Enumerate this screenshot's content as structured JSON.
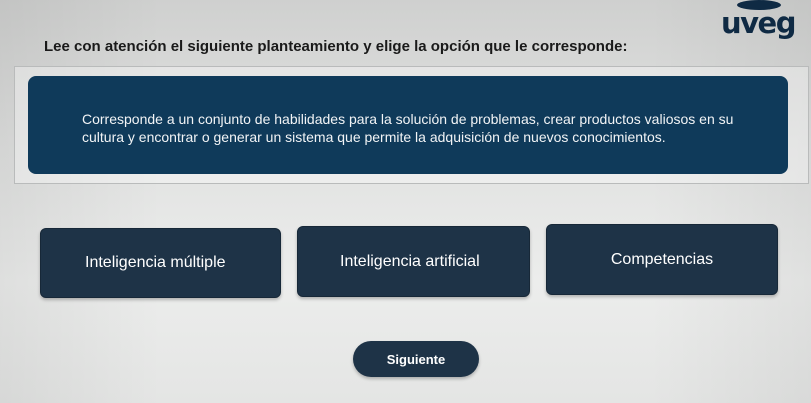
{
  "brand": {
    "logo_text": "uveg"
  },
  "question": {
    "instruction": "Lee con atención el siguiente planteamiento y elige la opción que le corresponde:",
    "statement": "Corresponde a un conjunto de habilidades para la solución de problemas, crear productos valiosos en su cultura y encontrar o generar un sistema que permite la adquisición de nuevos conocimientos."
  },
  "options": [
    {
      "label": "Inteligencia múltiple"
    },
    {
      "label": "Inteligencia artificial"
    },
    {
      "label": "Competencias"
    }
  ],
  "navigation": {
    "next_label": "Siguiente"
  },
  "colors": {
    "statement_bg": "#0f3a5a",
    "option_bg": "#1e3347",
    "brand": "#0f2a44"
  }
}
